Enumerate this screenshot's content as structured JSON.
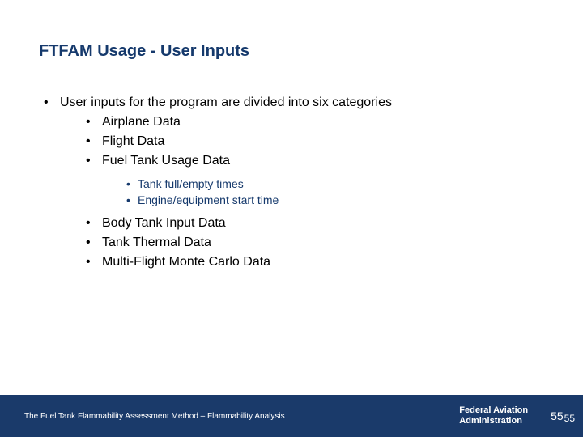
{
  "title": "FTFAM Usage - User Inputs",
  "bullet": "•",
  "intro": "User inputs for the program are divided into six categories",
  "cats_a": {
    "c0": "Airplane Data",
    "c1": "Flight Data",
    "c2": "Fuel Tank Usage Data"
  },
  "sub": {
    "s0": "Tank full/empty times",
    "s1": "Engine/equipment start time"
  },
  "cats_b": {
    "c0": "Body Tank Input Data",
    "c1": "Tank Thermal Data",
    "c2": "Multi-Flight Monte Carlo Data"
  },
  "footer": {
    "left": "The Fuel Tank Flammability Assessment Method – Flammability Analysis",
    "org1": "Federal Aviation",
    "org2": "Administration",
    "pgA": "55",
    "pgB": "55"
  }
}
